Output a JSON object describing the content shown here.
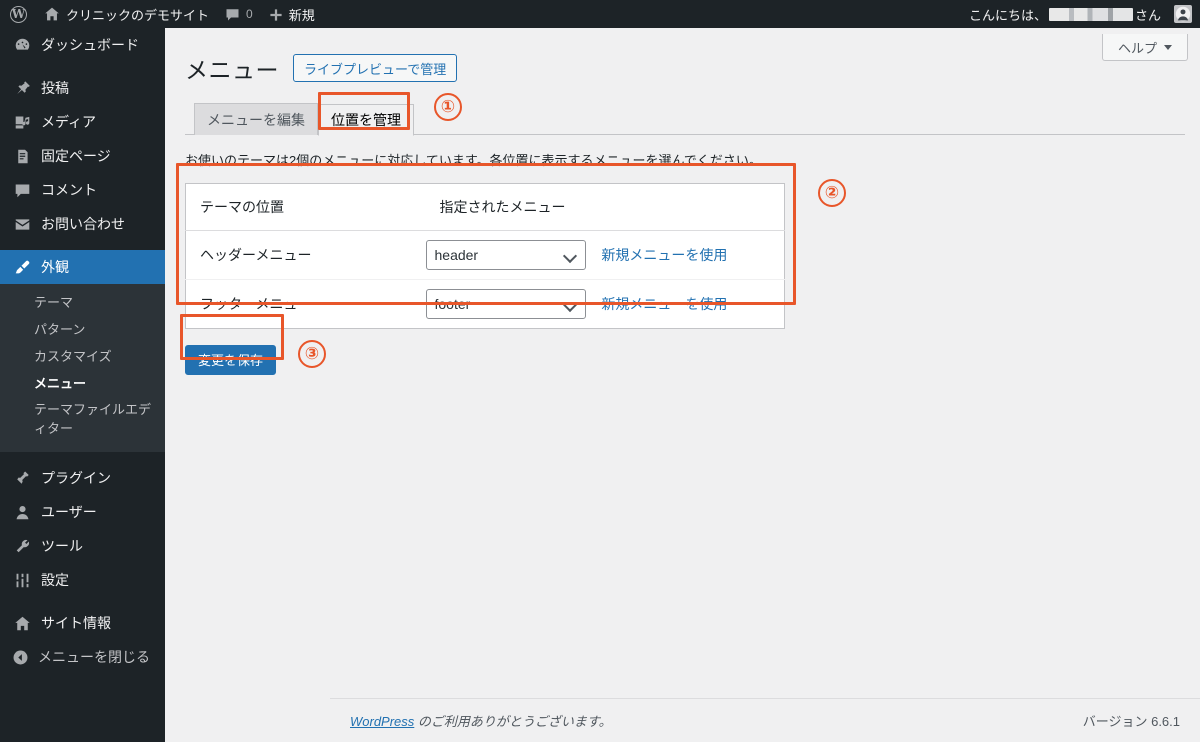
{
  "adminbar": {
    "logo_icon": "wordpress-logo-icon",
    "site_icon": "home-icon",
    "site_name": "クリニックのデモサイト",
    "comment_icon": "comment-bubble-icon",
    "comment_count": "0",
    "new_icon": "plus-icon",
    "new_label": "新規",
    "greeting_prefix": "こんにちは、",
    "greeting_suffix": "さん",
    "avatar_icon": "avatar-icon"
  },
  "sidebar": {
    "items": [
      {
        "label": "ダッシュボード",
        "icon": "dashboard-icon",
        "current": false,
        "gap": false
      },
      {
        "label": "投稿",
        "icon": "pin-icon",
        "current": false,
        "gap": true
      },
      {
        "label": "メディア",
        "icon": "media-icon",
        "current": false,
        "gap": false
      },
      {
        "label": "固定ページ",
        "icon": "page-icon",
        "current": false,
        "gap": false
      },
      {
        "label": "コメント",
        "icon": "comment-icon",
        "current": false,
        "gap": false
      },
      {
        "label": "お問い合わせ",
        "icon": "mail-icon",
        "current": false,
        "gap": false
      },
      {
        "label": "外観",
        "icon": "appearance-brush-icon",
        "current": true,
        "gap": true
      }
    ],
    "submenu": [
      {
        "label": "テーマ",
        "current": false
      },
      {
        "label": "パターン",
        "current": false
      },
      {
        "label": "カスタマイズ",
        "current": false
      },
      {
        "label": "メニュー",
        "current": true
      },
      {
        "label": "テーマファイルエディター",
        "current": false
      }
    ],
    "items_after": [
      {
        "label": "プラグイン",
        "icon": "plugin-icon",
        "current": false,
        "gap": true
      },
      {
        "label": "ユーザー",
        "icon": "user-icon",
        "current": false,
        "gap": false
      },
      {
        "label": "ツール",
        "icon": "wrench-icon",
        "current": false,
        "gap": false
      },
      {
        "label": "設定",
        "icon": "settings-sliders-icon",
        "current": false,
        "gap": false
      },
      {
        "label": "サイト情報",
        "icon": "home-info-icon",
        "current": false,
        "gap": true
      }
    ],
    "collapse": {
      "label": "メニューを閉じる",
      "icon": "collapse-arrow-icon"
    }
  },
  "help": {
    "label": "ヘルプ",
    "icon": "chevron-down-icon"
  },
  "page": {
    "title": "メニュー",
    "live_preview_button": "ライブプレビューで管理",
    "tabs": [
      {
        "label": "メニューを編集",
        "active": false
      },
      {
        "label": "位置を管理",
        "active": true
      }
    ],
    "description": "お使いのテーマは2個のメニューに対応しています。各位置に表示するメニューを選んでください。",
    "table": {
      "headers": [
        "テーマの位置",
        "指定されたメニュー"
      ],
      "rows": [
        {
          "position": "ヘッダーメニュー",
          "selected": "header",
          "link": "新規メニューを使用"
        },
        {
          "position": "フッターメニュー",
          "selected": "footer",
          "link": "新規メニューを使用"
        }
      ]
    },
    "save_button": "変更を保存"
  },
  "annotations": {
    "color": "#e8562a",
    "markers": [
      {
        "id": "1",
        "text": "①"
      },
      {
        "id": "2",
        "text": "②"
      },
      {
        "id": "3",
        "text": "③"
      }
    ]
  },
  "footer": {
    "link_text": "WordPress",
    "thanks_text": " のご利用ありがとうございます。",
    "version": "バージョン 6.6.1"
  }
}
